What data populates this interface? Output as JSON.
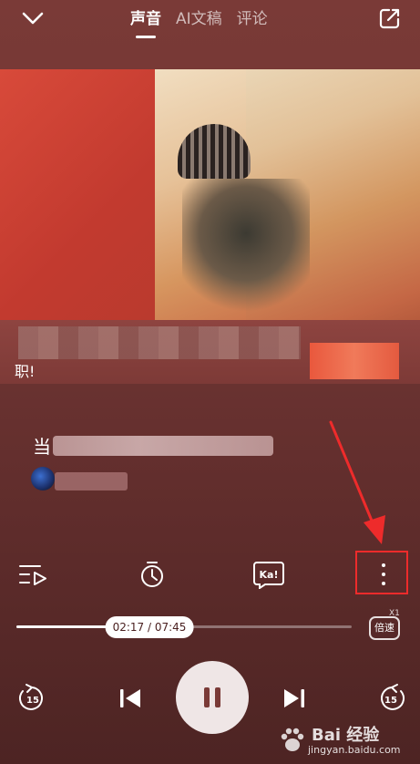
{
  "header": {
    "tabs": [
      {
        "label": "声音",
        "active": true
      },
      {
        "label": "AI文稿",
        "active": false
      },
      {
        "label": "评论",
        "active": false
      }
    ],
    "collapse_icon": "chevron-down-icon",
    "share_icon": "share-icon"
  },
  "cover": {
    "caption": "职!"
  },
  "lyrics": {
    "current_line_start": "当"
  },
  "functions": [
    {
      "name": "playlist",
      "icon": "playlist-icon"
    },
    {
      "name": "timer",
      "icon": "timer-icon"
    },
    {
      "name": "karaoke",
      "icon": "karaoke-icon",
      "label": "Ka!"
    },
    {
      "name": "more",
      "icon": "more-vertical-icon"
    }
  ],
  "player": {
    "current_time": "02:17",
    "total_time": "07:45",
    "time_display": "02:17 / 07:45",
    "progress_fraction": 0.294,
    "speed_label": "倍速",
    "speed_badge": "X1",
    "rewind_label": "15",
    "forward_label": "15"
  },
  "watermark": {
    "brand": "Bai 经验",
    "url": "jingyan.baidu.com"
  },
  "colors": {
    "annotation": "#ee2b2b",
    "background": "#6f3533"
  }
}
